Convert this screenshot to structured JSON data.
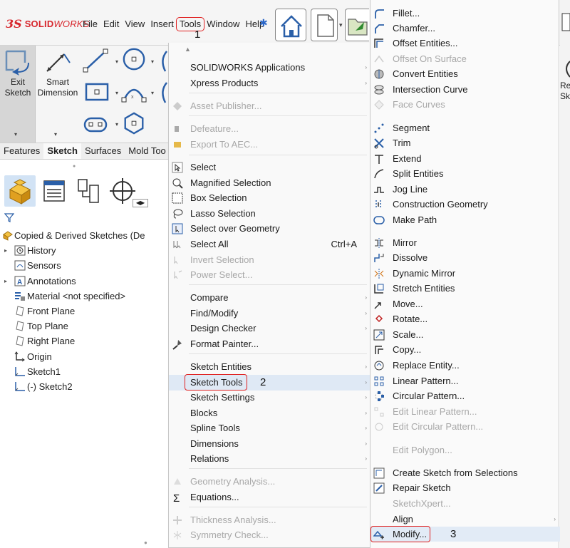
{
  "app": {
    "logo_ds": "3S",
    "logo_text_bold": "SOLID",
    "logo_text_italic": "WORKS"
  },
  "menubar": {
    "items": [
      "File",
      "Edit",
      "View",
      "Insert",
      "Tools",
      "Window",
      "Help"
    ],
    "highlighted": "Tools",
    "step_label": "1"
  },
  "command_manager": {
    "exit_sketch": "Exit\nSketch",
    "smart_dimension": "Smart\nDimension"
  },
  "tabs": [
    "Features",
    "Sketch",
    "Surfaces",
    "Mold Too"
  ],
  "active_tab": "Sketch",
  "tree": {
    "root": "Copied & Derived Sketches  (De",
    "items": [
      {
        "label": "History",
        "expandable": true,
        "icon": "history-icon"
      },
      {
        "label": "Sensors",
        "expandable": false,
        "icon": "sensor-icon"
      },
      {
        "label": "Annotations",
        "expandable": true,
        "icon": "annotation-icon"
      },
      {
        "label": "Material <not specified>",
        "expandable": false,
        "icon": "material-icon"
      },
      {
        "label": "Front Plane",
        "expandable": false,
        "icon": "plane-icon"
      },
      {
        "label": "Top Plane",
        "expandable": false,
        "icon": "plane-icon"
      },
      {
        "label": "Right Plane",
        "expandable": false,
        "icon": "plane-icon"
      },
      {
        "label": "Origin",
        "expandable": false,
        "icon": "origin-icon"
      },
      {
        "label": "Sketch1",
        "expandable": false,
        "icon": "sketch-icon"
      },
      {
        "label": "(-) Sketch2",
        "expandable": false,
        "icon": "sketch-icon"
      }
    ]
  },
  "tools_menu": {
    "items": [
      {
        "label": "SOLIDWORKS Applications",
        "submenu": true
      },
      {
        "label": "Xpress Products",
        "submenu": true
      },
      {
        "label": "Asset Publisher...",
        "disabled": true
      },
      {
        "label": "Defeature...",
        "disabled": true
      },
      {
        "label": "Export To AEC...",
        "disabled": true
      },
      {
        "label": "Select"
      },
      {
        "label": "Magnified Selection"
      },
      {
        "label": "Box Selection"
      },
      {
        "label": "Lasso Selection"
      },
      {
        "label": "Select over Geometry"
      },
      {
        "label": "Select All",
        "shortcut": "Ctrl+A"
      },
      {
        "label": "Invert Selection",
        "disabled": true
      },
      {
        "label": "Power Select...",
        "disabled": true
      },
      {
        "label": "Compare",
        "submenu": true
      },
      {
        "label": "Find/Modify",
        "submenu": true
      },
      {
        "label": "Design Checker",
        "submenu": true
      },
      {
        "label": "Format Painter..."
      },
      {
        "label": "Sketch Entities",
        "submenu": true
      },
      {
        "label": "Sketch Tools",
        "submenu": true
      },
      {
        "label": "Sketch Settings",
        "submenu": true
      },
      {
        "label": "Blocks",
        "submenu": true
      },
      {
        "label": "Spline Tools",
        "submenu": true
      },
      {
        "label": "Dimensions",
        "submenu": true
      },
      {
        "label": "Relations",
        "submenu": true
      },
      {
        "label": "Geometry Analysis...",
        "disabled": true
      },
      {
        "label": "Equations..."
      },
      {
        "label": "Thickness Analysis...",
        "disabled": true
      },
      {
        "label": "Symmetry Check...",
        "disabled": true
      }
    ],
    "highlighted": "Sketch Tools",
    "step_label": "2"
  },
  "sketch_tools_menu": {
    "items": [
      {
        "label": "Fillet..."
      },
      {
        "label": "Chamfer..."
      },
      {
        "label": "Offset Entities..."
      },
      {
        "label": "Offset On Surface",
        "disabled": true
      },
      {
        "label": "Convert Entities"
      },
      {
        "label": "Intersection Curve"
      },
      {
        "label": "Face Curves",
        "disabled": true
      },
      {
        "label": "Segment"
      },
      {
        "label": "Trim"
      },
      {
        "label": "Extend"
      },
      {
        "label": "Split Entities"
      },
      {
        "label": "Jog Line"
      },
      {
        "label": "Construction Geometry"
      },
      {
        "label": "Make Path"
      },
      {
        "label": "Mirror"
      },
      {
        "label": "Dissolve"
      },
      {
        "label": "Dynamic Mirror"
      },
      {
        "label": "Stretch Entities"
      },
      {
        "label": "Move..."
      },
      {
        "label": "Rotate..."
      },
      {
        "label": "Scale..."
      },
      {
        "label": "Copy..."
      },
      {
        "label": "Replace Entity..."
      },
      {
        "label": "Linear Pattern..."
      },
      {
        "label": "Circular Pattern..."
      },
      {
        "label": "Edit Linear Pattern...",
        "disabled": true
      },
      {
        "label": "Edit Circular Pattern...",
        "disabled": true
      },
      {
        "label": "Edit Polygon...",
        "disabled": true
      },
      {
        "label": "Create Sketch from Selections"
      },
      {
        "label": "Repair Sketch"
      },
      {
        "label": "SketchXpert...",
        "disabled": true
      },
      {
        "label": "Align",
        "submenu": true
      },
      {
        "label": "Modify..."
      }
    ],
    "highlighted": "Modify...",
    "step_label": "3"
  },
  "colors": {
    "accent_red": "#e02020",
    "icon_blue": "#2a5fa8",
    "hover": "#dfe9f5"
  },
  "edge_text": {
    "line1": "Rep",
    "line2": "Ske"
  }
}
